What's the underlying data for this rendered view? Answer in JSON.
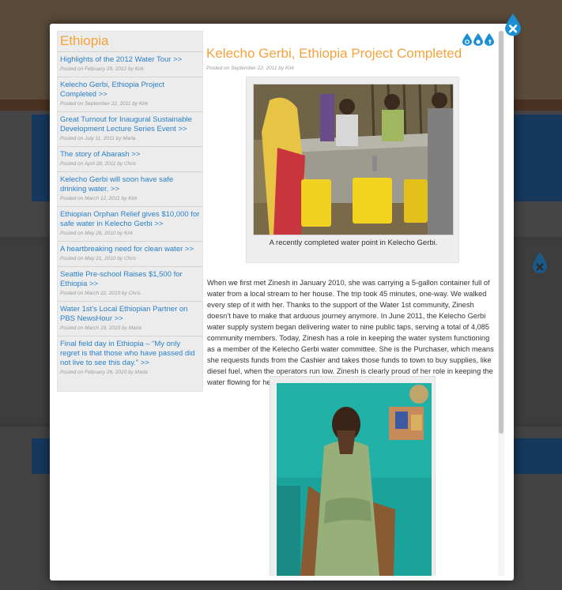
{
  "sidebar": {
    "title": "Ethiopia",
    "items": [
      {
        "title": "Highlights of the 2012 Water Tour >>",
        "meta": "Posted on February 29, 2012 by Kirk"
      },
      {
        "title": "Kelecho Gerbi, Ethiopia Project Completed >>",
        "meta": "Posted on September 22, 2011 by Kirk"
      },
      {
        "title": "Great Turnout for Inaugural Sustainable Development Lecture Series Event >>",
        "meta": "Posted on July 11, 2011 by Marla"
      },
      {
        "title": "The story of Abarash >>",
        "meta": "Posted on April 28, 2011 by Chris"
      },
      {
        "title": "Kelecho Gerbi will soon have safe drinking water. >>",
        "meta": "Posted on March 12, 2011 by Kirk"
      },
      {
        "title": "Ethiopian Orphan Relief gives $10,000 for safe water in Kelecho Gerbi >>",
        "meta": "Posted on May 28, 2010 by Kirk"
      },
      {
        "title": "A heartbreaking need for clean water >>",
        "meta": "Posted on May 21, 2010 by Chris"
      },
      {
        "title": "Seattle Pre-school Raises $1,500 for Ethiopia >>",
        "meta": "Posted on March 22, 2010 by Chris"
      },
      {
        "title": "Water 1st's Local Ethiopian Partner on PBS NewsHour >>",
        "meta": "Posted on March 19, 2010 by Marla"
      },
      {
        "title": "Final field day in Ethiopia – “My only regret is that those who have passed did not live to see this day.” >>",
        "meta": "Posted on February 26, 2010 by Marla"
      }
    ]
  },
  "article": {
    "title": "Kelecho Gerbi, Ethiopia Project Completed",
    "meta": "Posted on September 22, 2011 by Kirk",
    "caption": "A recently completed water point in Kelecho Gerbi.",
    "body": "When we first met Zinesh in January 2010, she was carrying a 5-gallon container full of water from a local stream to her house. The trip took 45 minutes, one-way. We walked every step of it with her. Thanks to the support of the Water 1st community, Zinesh doesn’t have to make that arduous journey anymore. In June 2011, the Kelecho Gerbi water supply system began delivering water to nine public taps, serving a total of 4,085 community members. Today, Zinesh has a role in keeping the water system functioning as a member of the Kelecho Gerbi water committee. She is the Purchaser, which means she requests funds from the Cashier and takes those funds to town to buy supplies, like diesel fuel, when the operators run low. Zinesh is clearly proud of her role in keeping the water flowing for her community."
  },
  "colors": {
    "accent": "#f5a23b",
    "link": "#2a80c8",
    "drop": "#1a8fd6"
  },
  "icons": [
    "close-icon",
    "share-water-drop-icon",
    "email-drop-icon",
    "facebook-drop-icon"
  ]
}
